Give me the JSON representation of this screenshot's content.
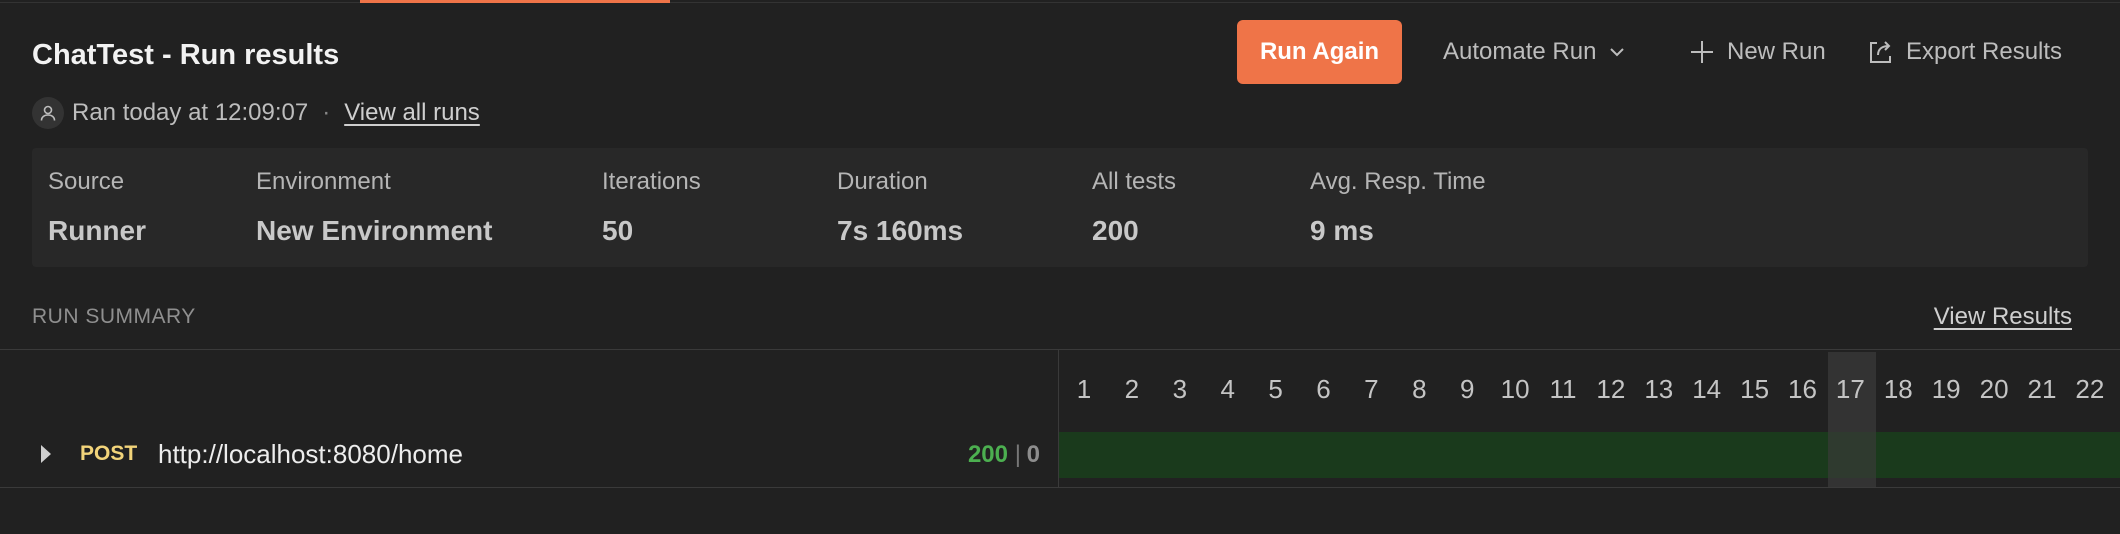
{
  "header": {
    "title": "ChatTest - Run results",
    "ran_text": "Ran today at 12:09:07",
    "separator": "·",
    "view_all_runs": "View all runs"
  },
  "actions": {
    "run_again": "Run Again",
    "automate_run": "Automate Run",
    "new_run": "New Run",
    "export_results": "Export Results"
  },
  "stats": [
    {
      "label": "Source",
      "value": "Runner"
    },
    {
      "label": "Environment",
      "value": "New Environment"
    },
    {
      "label": "Iterations",
      "value": "50"
    },
    {
      "label": "Duration",
      "value": "7s 160ms"
    },
    {
      "label": "All tests",
      "value": "200"
    },
    {
      "label": "Avg. Resp. Time",
      "value": "9 ms"
    }
  ],
  "summary": {
    "heading": "RUN SUMMARY",
    "view_results": "View Results"
  },
  "iterations": [
    "1",
    "2",
    "3",
    "4",
    "5",
    "6",
    "7",
    "8",
    "9",
    "10",
    "11",
    "12",
    "13",
    "14",
    "15",
    "16",
    "17",
    "18",
    "19",
    "20",
    "21",
    "22"
  ],
  "selected_iteration": "17",
  "request": {
    "method": "POST",
    "url": "http://localhost:8080/home",
    "passed": "200",
    "divider": "|",
    "failed": "0"
  },
  "colors": {
    "accent": "#ef7448",
    "pass": "#4caf50",
    "method": "#f2d47a",
    "bar": "#1a3a1c"
  }
}
